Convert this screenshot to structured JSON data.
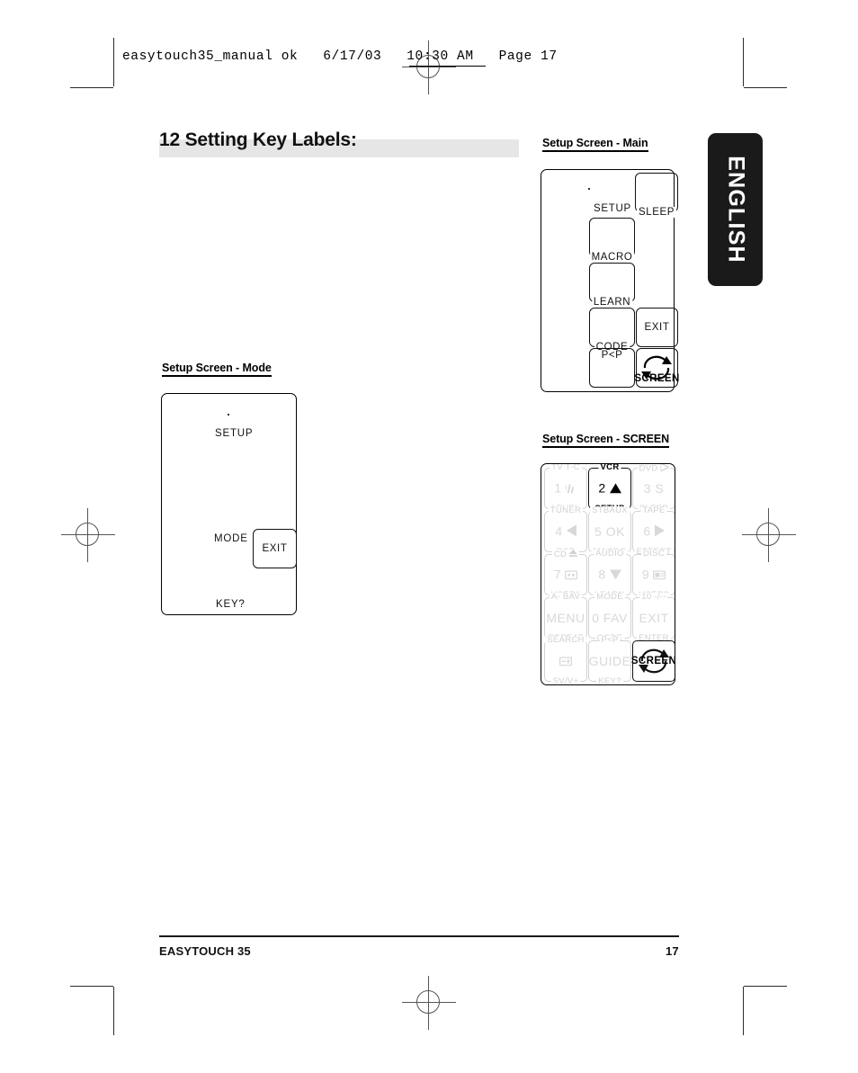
{
  "slug": {
    "text": "easytouch35_manual ok   6/17/03   10:30 AM   Page 17"
  },
  "lang_tab": {
    "label": "ENGLISH"
  },
  "section": {
    "number": "12",
    "title": "12 Setting Key Labels:",
    "band_color": "#e6e6e6"
  },
  "figures": {
    "mode": {
      "caption": "Setup Screen - Mode",
      "labels": {
        "setup": "SETUP",
        "mode": "MODE",
        "key": "KEY?",
        "exit": "EXIT"
      }
    },
    "main": {
      "caption": "Setup Screen - Main",
      "keys": {
        "setup": "SETUP",
        "sleep": "SLEEP",
        "macro": "MACRO",
        "learn": "LEARN",
        "code": "CODE",
        "exit": "EXIT",
        "pvp": "P<P",
        "screen": "SCREEN"
      }
    },
    "screen": {
      "caption": "Setup Screen - SCREEN",
      "rows": [
        [
          {
            "top": "TV  T-C",
            "mid": "1",
            "mid_icon": "equalizer-icon",
            "bottom": "LEVEL",
            "active": false
          },
          {
            "top": "VCR",
            "mid": "2",
            "mid_icon": "triangle-up-icon",
            "bottom": "SETUP",
            "active": true
          },
          {
            "top": "DVD",
            "top_icon": "play-icon",
            "mid": "3  S",
            "bottom": "SLEEP",
            "active": false
          }
        ],
        [
          {
            "top": "TUNER",
            "mid": "4",
            "mid_icon": "triangle-left-icon",
            "bottom": "DSP",
            "active": false
          },
          {
            "top": "STBAUX",
            "mid": "5  OK",
            "bottom": "MACRO",
            "active": false
          },
          {
            "top": "TAPE",
            "mid": "6",
            "mid_icon": "triangle-right-icon",
            "bottom": "EFFECT",
            "active": false
          }
        ],
        [
          {
            "top": "CD",
            "top_icon": "eject-icon",
            "mid": "7",
            "mid_icon": "cassette-icon",
            "bottom": "USER1",
            "active": false
          },
          {
            "top": "AUDIO",
            "mid": "8",
            "mid_icon": "triangle-down-icon",
            "bottom": "LEARN",
            "active": false
          },
          {
            "top": "DISC",
            "mid": "9",
            "mid_icon": "display-icon",
            "bottom": "USER2",
            "active": false
          }
        ],
        [
          {
            "top": "A- BAV",
            "mid": "MENU",
            "bottom": "REPEAT",
            "active": false
          },
          {
            "top": "MODE",
            "mid": "0  FAV",
            "bottom": "CODE",
            "active": false
          },
          {
            "top": "10  -/--",
            "mid": "EXIT",
            "bottom": "ENTER",
            "active": false
          }
        ],
        [
          {
            "top": "SEARCH",
            "mid": "",
            "mid_icon": "display-plus-icon",
            "bottom": "SV/V+",
            "active": false
          },
          {
            "top": "P<P",
            "mid": "GUIDE",
            "bottom": "KEY?",
            "active": false
          },
          {
            "top": "",
            "mid": "SCREEN",
            "mid_icon": "cycle-arrows-icon",
            "bottom": "",
            "active": true
          }
        ]
      ]
    }
  },
  "footer": {
    "product": "EASYTOUCH 35",
    "page_number": "17"
  }
}
